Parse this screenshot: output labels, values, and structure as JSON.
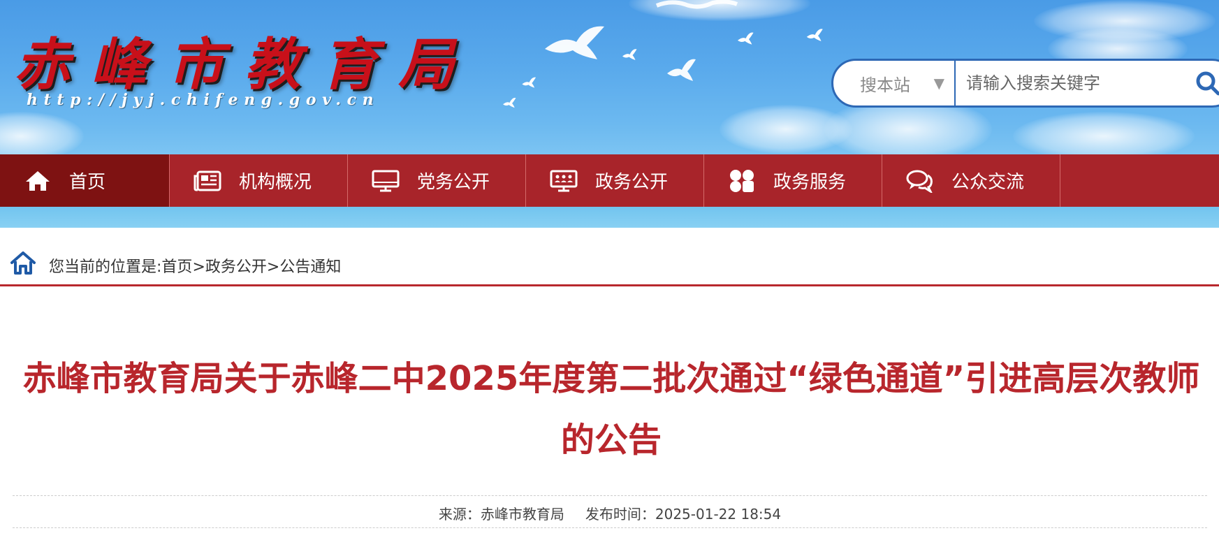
{
  "header": {
    "logo_text": "赤峰市教育局",
    "url_text": "http://jyj.chifeng.gov.cn"
  },
  "search": {
    "scope_label": "搜本站",
    "placeholder": "请输入搜索关键字"
  },
  "nav": {
    "items": [
      {
        "label": "首页",
        "icon": "home-icon"
      },
      {
        "label": "机构概况",
        "icon": "newspaper-icon"
      },
      {
        "label": "党务公开",
        "icon": "monitor-icon"
      },
      {
        "label": "政务公开",
        "icon": "meeting-icon"
      },
      {
        "label": "政务服务",
        "icon": "grid-icon"
      },
      {
        "label": "公众交流",
        "icon": "chat-icon"
      }
    ]
  },
  "breadcrumb": {
    "prefix": "您当前的位置是:",
    "home": "首页",
    "sep": ">",
    "section": "政务公开",
    "current": "公告通知"
  },
  "article": {
    "title": "赤峰市教育局关于赤峰二中2025年度第二批次通过“绿色通道”引进高层次教师的公告",
    "source_label": "来源：",
    "source": "赤峰市教育局",
    "time_label": "发布时间：",
    "time": "2025-01-22 18:54"
  },
  "colors": {
    "nav_red": "#a8242a",
    "nav_active": "#7e1212",
    "title_red": "#b8262c",
    "search_blue": "#2d68b5"
  }
}
